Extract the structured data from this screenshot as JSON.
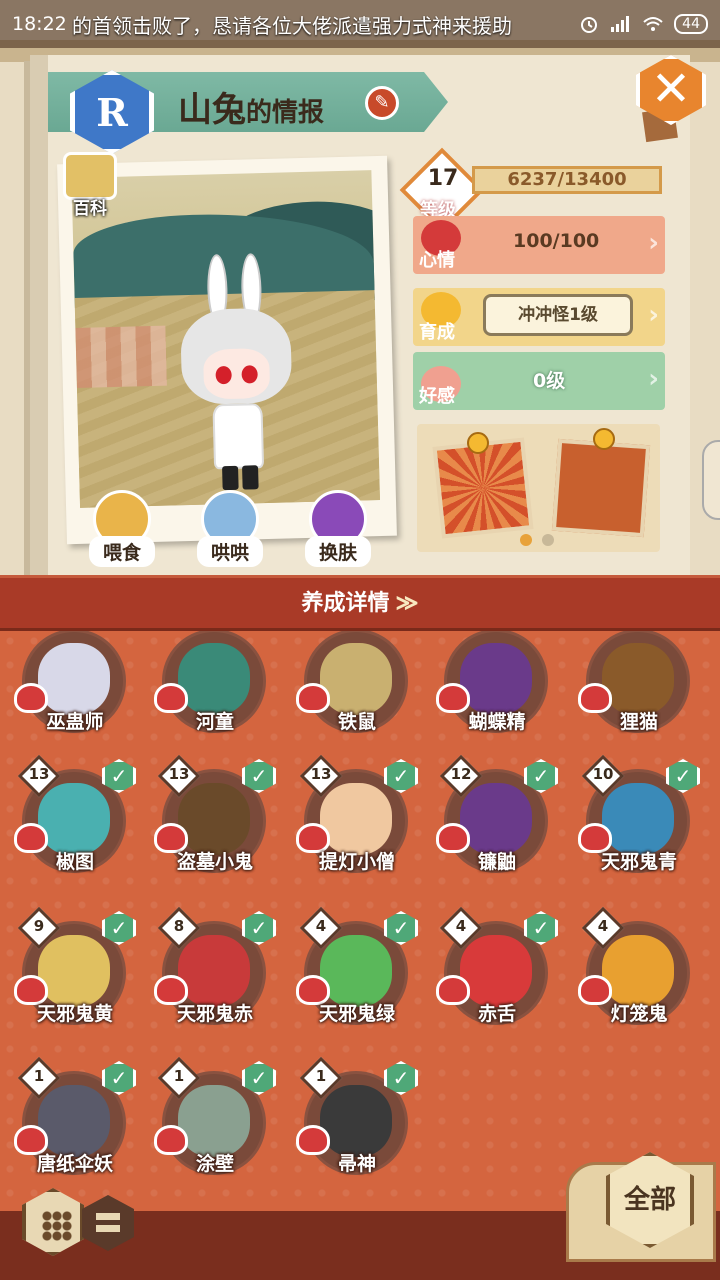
{
  "status_bar": {
    "time": "18:22",
    "marquee": "的首领击败了，恳请各位大佬派遣强力式神来援助",
    "battery": "44"
  },
  "header": {
    "rank": "R",
    "name": "山兔",
    "title_suffix": "的情报"
  },
  "wiki_label": "百科",
  "actions": [
    {
      "label": "喂食",
      "color": "#e9b44a"
    },
    {
      "label": "哄哄",
      "color": "#8ab8e0"
    },
    {
      "label": "换肤",
      "color": "#8a4ab8"
    }
  ],
  "stats": {
    "level": "17",
    "level_label": "等级",
    "exp": "6237/13400",
    "mood_label": "心情",
    "mood": "100/100",
    "growth_label": "育成",
    "growth": "冲冲怪1级",
    "favor_label": "好感",
    "favor": "0级"
  },
  "colors": {
    "mood_row": "#f0a88a",
    "growth_row": "#f2d58a",
    "favor_row": "#9fd0a8",
    "check": "#4fa878"
  },
  "page_dots": {
    "count": 2,
    "active": 0
  },
  "detail_bar": {
    "label": "养成详情",
    "icon": "double-chevron-down-icon"
  },
  "shikigami": [
    {
      "name": "巫蛊师",
      "level": "",
      "checked": false,
      "color": "#d8d8e8"
    },
    {
      "name": "河童",
      "level": "",
      "checked": false,
      "color": "#3a8a78"
    },
    {
      "name": "铁鼠",
      "level": "",
      "checked": false,
      "color": "#c9b070"
    },
    {
      "name": "蝴蝶精",
      "level": "",
      "checked": false,
      "color": "#6a3a8a"
    },
    {
      "name": "狸猫",
      "level": "",
      "checked": false,
      "color": "#8a5a2a"
    },
    {
      "name": "椒图",
      "level": "13",
      "checked": true,
      "color": "#4ab0b0"
    },
    {
      "name": "盗墓小鬼",
      "level": "13",
      "checked": true,
      "color": "#6a4a2a"
    },
    {
      "name": "提灯小僧",
      "level": "13",
      "checked": true,
      "color": "#f0c8a0"
    },
    {
      "name": "镰鼬",
      "level": "12",
      "checked": true,
      "color": "#6a3a8a"
    },
    {
      "name": "天邪鬼青",
      "level": "10",
      "checked": true,
      "color": "#3a8ab8"
    },
    {
      "name": "天邪鬼黄",
      "level": "9",
      "checked": true,
      "color": "#e0c060"
    },
    {
      "name": "天邪鬼赤",
      "level": "8",
      "checked": true,
      "color": "#c83a3a"
    },
    {
      "name": "天邪鬼绿",
      "level": "4",
      "checked": true,
      "color": "#5ab85a"
    },
    {
      "name": "赤舌",
      "level": "4",
      "checked": true,
      "color": "#d83a3a"
    },
    {
      "name": "灯笼鬼",
      "level": "4",
      "checked": false,
      "color": "#e8a030"
    },
    {
      "name": "唐纸伞妖",
      "level": "1",
      "checked": true,
      "color": "#5a5a6a"
    },
    {
      "name": "涂壁",
      "level": "1",
      "checked": true,
      "color": "#8aa090"
    },
    {
      "name": "帚神",
      "level": "1",
      "checked": true,
      "color": "#3a3a3a"
    }
  ],
  "bottom": {
    "all_label": "全部"
  }
}
